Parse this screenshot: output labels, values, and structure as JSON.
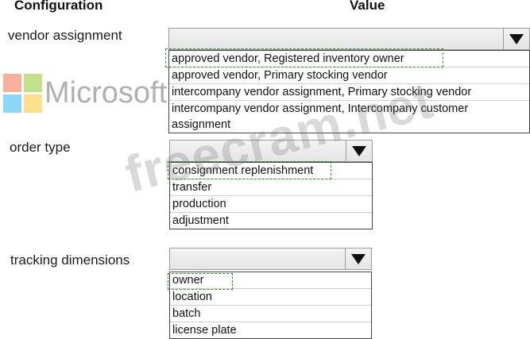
{
  "headers": {
    "configuration": "Configuration",
    "value": "Value"
  },
  "rows": [
    {
      "label": "vendor assignment",
      "options": [
        "approved vendor, Registered inventory owner",
        "approved vendor, Primary stocking vendor",
        "intercompany vendor assignment, Primary stocking vendor",
        "intercompany vendor assignment, Intercompany customer assignment"
      ],
      "selected_index": 0
    },
    {
      "label": "order type",
      "options": [
        "consignment replenishment",
        "transfer",
        "production",
        "adjustment"
      ],
      "selected_index": 0
    },
    {
      "label": "tracking dimensions",
      "options": [
        "owner",
        "location",
        "batch",
        "license plate"
      ],
      "selected_index": 0
    }
  ],
  "watermark": {
    "text": "freecram.net",
    "logo_text": "Microsoft"
  },
  "icons": [
    "dropdown-arrow-icon",
    "microsoft-logo-icon"
  ],
  "colors": {
    "selection_border": "#3d8a3d",
    "dropdown_bg": "#e9e9e9"
  }
}
